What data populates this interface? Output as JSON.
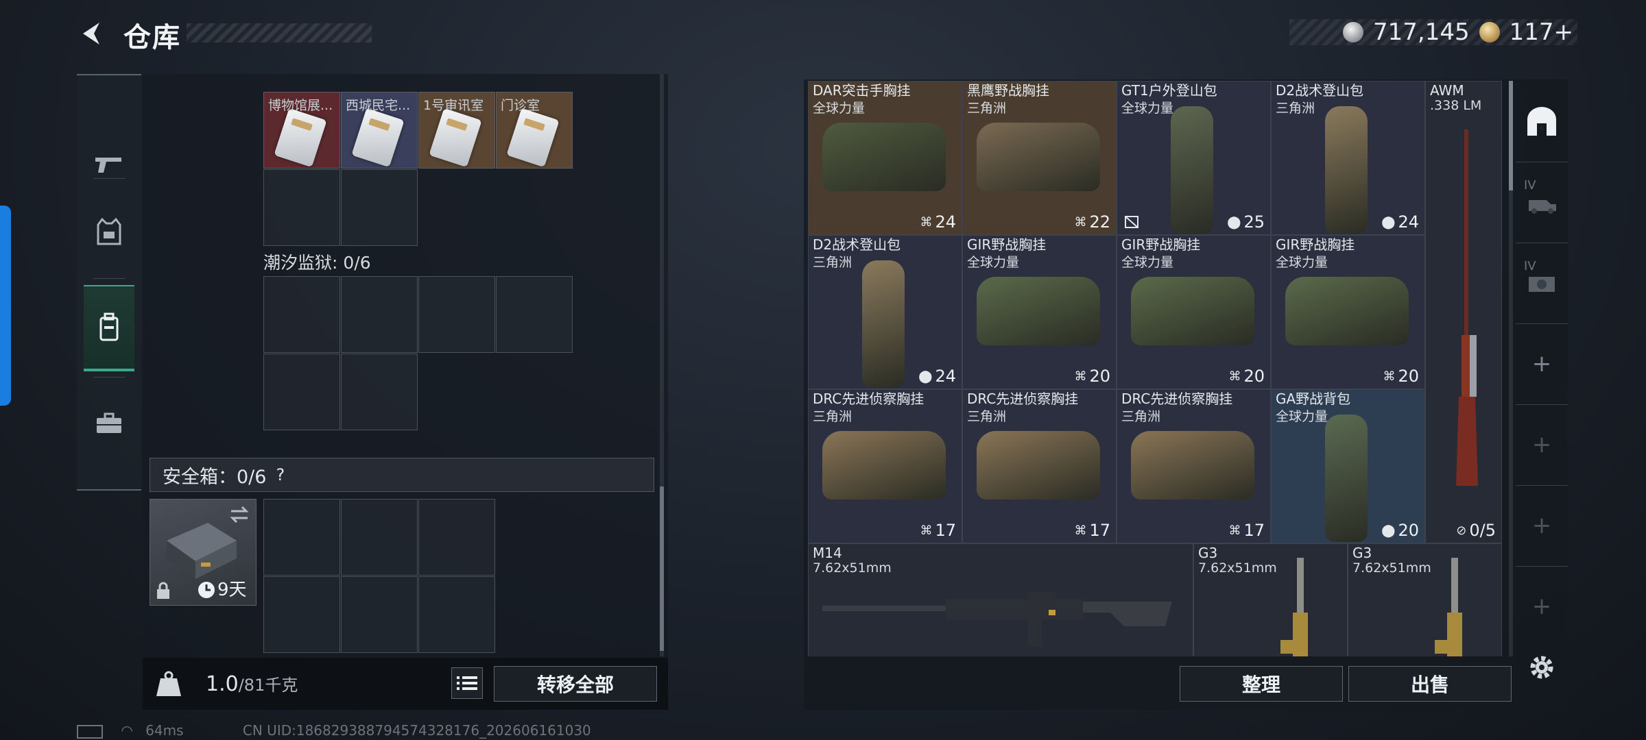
{
  "header": {
    "title": "仓库"
  },
  "currency": {
    "silver": "717,145",
    "gold": "117+"
  },
  "keycards": [
    {
      "label": "博物馆展...",
      "bg": "#5c2a2e"
    },
    {
      "label": "西城民宅...",
      "bg": "#3a3f5c"
    },
    {
      "label": "1号审讯室",
      "bg": "#5a4532"
    },
    {
      "label": "门诊室",
      "bg": "#5a4532"
    }
  ],
  "prison": {
    "label": "潮汐监狱: 0/6"
  },
  "safebox": {
    "label": "安全箱：0/6",
    "help": "?",
    "timer": "9天"
  },
  "weight": {
    "current": "1.0",
    "max": "/81千克"
  },
  "buttons": {
    "transfer_all": "转移全部",
    "sort": "整理",
    "sell": "出售"
  },
  "status": {
    "ping": "64ms",
    "uid": "CN UID:18682938879457432817​6_202606161030"
  },
  "stash": [
    {
      "name": "DAR突击手胸挂",
      "sub": "全球力量",
      "dur": "24",
      "kind": "rig",
      "bg": "#4a3c2e",
      "tint": "#4f5a3e"
    },
    {
      "name": "黑鹰野战胸挂",
      "sub": "三角洲",
      "dur": "22",
      "kind": "rig",
      "bg": "#4a3c2e",
      "tint": "#7b6a52"
    },
    {
      "name": "GT1户外登山包",
      "sub": "全球力量",
      "dur": "25",
      "kind": "pack",
      "bg": "#2c2f40",
      "tint": "#5d6650",
      "broken": true
    },
    {
      "name": "D2战术登山包",
      "sub": "三角洲",
      "dur": "24",
      "kind": "pack",
      "bg": "#2c2f40",
      "tint": "#8a7a5c"
    },
    {
      "name": "D2战术登山包",
      "sub": "三角洲",
      "dur": "24",
      "kind": "pack",
      "bg": "#2c2f40",
      "tint": "#8a7a5c"
    },
    {
      "name": "GIR野战胸挂",
      "sub": "全球力量",
      "dur": "20",
      "kind": "rig",
      "bg": "#2c2f40",
      "tint": "#5a6a4a"
    },
    {
      "name": "GIR野战胸挂",
      "sub": "全球力量",
      "dur": "20",
      "kind": "rig",
      "bg": "#2c2f40",
      "tint": "#5a6a4a"
    },
    {
      "name": "GIR野战胸挂",
      "sub": "全球力量",
      "dur": "20",
      "kind": "rig",
      "bg": "#2c2f40",
      "tint": "#5a6a4a"
    },
    {
      "name": "DRC先进侦察胸挂",
      "sub": "三角洲",
      "dur": "17",
      "kind": "rig",
      "bg": "#2c2f40",
      "tint": "#8a7556"
    },
    {
      "name": "DRC先进侦察胸挂",
      "sub": "三角洲",
      "dur": "17",
      "kind": "rig",
      "bg": "#2c2f40",
      "tint": "#8a7556"
    },
    {
      "name": "DRC先进侦察胸挂",
      "sub": "三角洲",
      "dur": "17",
      "kind": "rig",
      "bg": "#2c2f40",
      "tint": "#8a7556"
    },
    {
      "name": "GA野战背包",
      "sub": "全球力量",
      "dur": "20",
      "kind": "pack",
      "bg": "#2d3e52",
      "tint": "#5a6a52"
    }
  ],
  "awm": {
    "name": "AWM",
    "sub": ".338 LM",
    "ammo": "0/5"
  },
  "rifles": [
    {
      "name": "M14",
      "sub": "7.62x51mm"
    },
    {
      "name": "G3",
      "sub": "7.62x51mm"
    },
    {
      "name": "G3",
      "sub": "7.62x51mm"
    }
  ],
  "side_slots": [
    "IV",
    "IV"
  ]
}
